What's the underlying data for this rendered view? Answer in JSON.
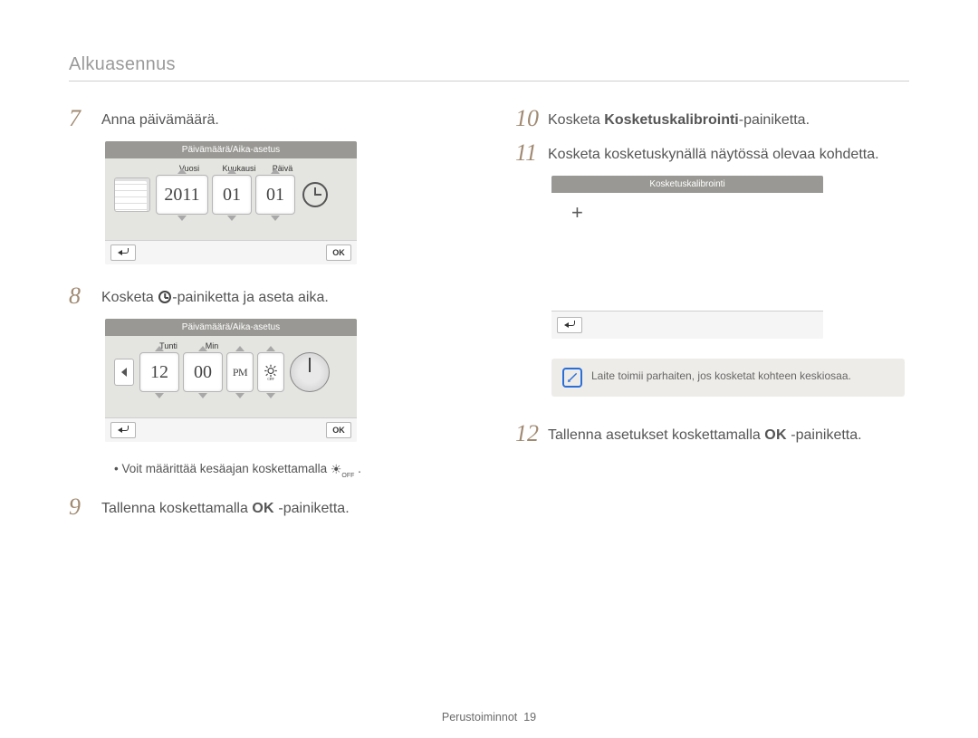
{
  "title": "Alkuasennus",
  "footer": {
    "label": "Perustoiminnot",
    "page": "19"
  },
  "left": {
    "step7": {
      "num": "7",
      "text": "Anna päivämäärä."
    },
    "date_device": {
      "title": "Päivämäärä/Aika-asetus",
      "labels": {
        "year": "Vuosi",
        "month": "Kuukausi",
        "day": "Päivä"
      },
      "values": {
        "year": "2011",
        "month": "01",
        "day": "01"
      },
      "ok": "OK"
    },
    "step8": {
      "num": "8",
      "pre": "Kosketa ",
      "post": "-painiketta ja aseta aika."
    },
    "time_device": {
      "title": "Päivämäärä/Aika-asetus",
      "labels": {
        "hour": "Tunti",
        "min": "Min"
      },
      "values": {
        "hour": "12",
        "min": "00",
        "ampm": "PM"
      },
      "ok": "OK"
    },
    "dst_note": "Voit määrittää kesäajan koskettamalla ",
    "dst_glyph": "☀",
    "dst_sub": "OFF",
    "step9": {
      "num": "9",
      "pre": "Tallenna koskettamalla ",
      "ok": "OK",
      "post": " -painiketta."
    }
  },
  "right": {
    "step10": {
      "num": "10",
      "pre": "Kosketa ",
      "bold": "Kosketuskalibrointi",
      "post": "-painiketta."
    },
    "step11": {
      "num": "11",
      "text": "Kosketa kosketuskynällä näytössä olevaa kohdetta."
    },
    "calib_device": {
      "title": "Kosketuskalibrointi",
      "target": "+"
    },
    "info": "Laite toimii parhaiten, jos kosketat kohteen keskiosaa.",
    "step12": {
      "num": "12",
      "pre": "Tallenna asetukset koskettamalla ",
      "ok": "OK",
      "post": " -painiketta."
    }
  }
}
